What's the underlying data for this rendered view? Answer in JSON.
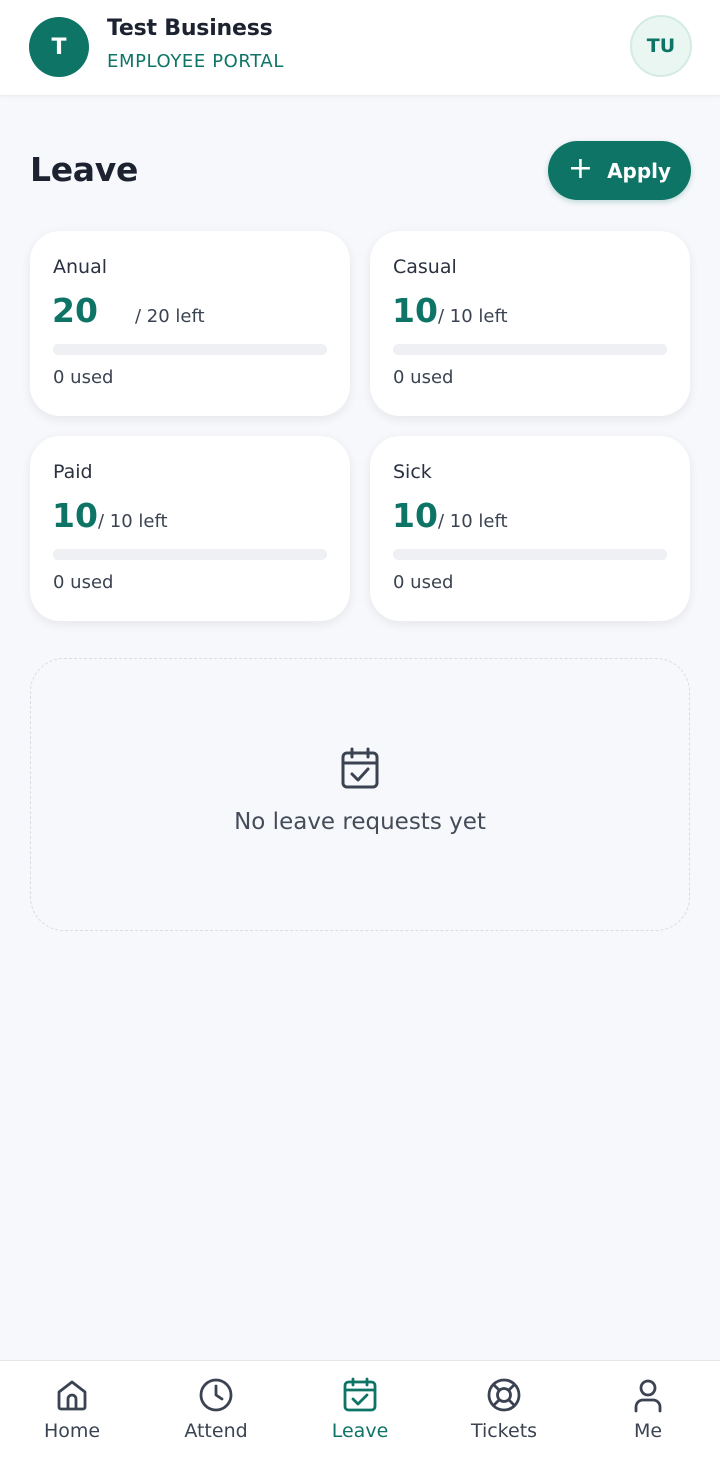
{
  "header": {
    "brand_initial": "T",
    "business_name": "Test Business",
    "portal_label": "EMPLOYEE PORTAL",
    "user_initials": "TU"
  },
  "page": {
    "title": "Leave",
    "apply_label": "Apply",
    "apply_icon": "plus-icon"
  },
  "leave_types": [
    {
      "name": "Anual",
      "remaining": "20",
      "left_label": "/ 20 left",
      "used_label": "0 used",
      "used_fraction": 0
    },
    {
      "name": "Casual",
      "remaining": "10",
      "left_label": "/ 10 left",
      "used_label": "0 used",
      "used_fraction": 0
    },
    {
      "name": "Paid",
      "remaining": "10",
      "left_label": "/ 10 left",
      "used_label": "0 used",
      "used_fraction": 0
    },
    {
      "name": "Sick",
      "remaining": "10",
      "left_label": "/ 10 left",
      "used_label": "0 used",
      "used_fraction": 0
    }
  ],
  "requests": {
    "empty_icon": "calendar-check-icon",
    "empty_message": "No leave requests yet"
  },
  "nav": {
    "active": "Leave",
    "items": [
      {
        "label": "Home",
        "icon": "home-icon"
      },
      {
        "label": "Attend",
        "icon": "clock-icon"
      },
      {
        "label": "Leave",
        "icon": "calendar-check-icon"
      },
      {
        "label": "Tickets",
        "icon": "lifebuoy-icon"
      },
      {
        "label": "Me",
        "icon": "user-icon"
      }
    ]
  },
  "colors": {
    "accent": "#0e7466",
    "background": "#f7f8fb",
    "text": "#1c2230"
  }
}
